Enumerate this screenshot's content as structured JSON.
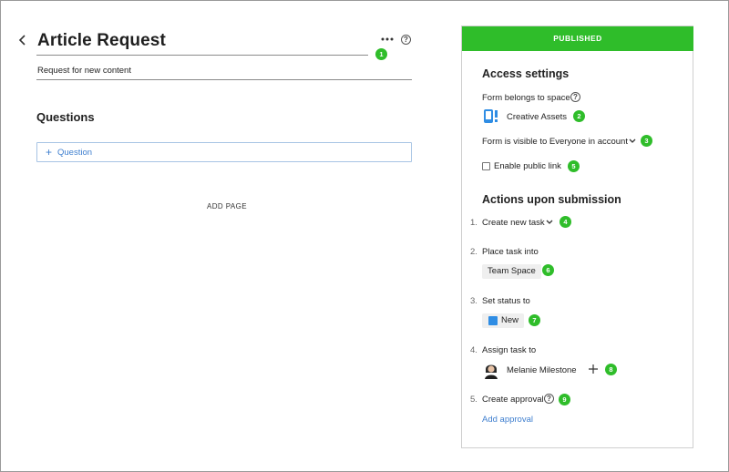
{
  "header": {
    "title": "Article Request",
    "description": "Request for new content",
    "back_icon": "chevron-left-icon",
    "more_icon": "more-horizontal-icon",
    "help_icon": "question-circle-icon"
  },
  "questions": {
    "heading": "Questions",
    "add_question_label": "Question",
    "add_page_label": "ADD PAGE"
  },
  "panel": {
    "status_banner": "PUBLISHED",
    "access": {
      "heading": "Access settings",
      "space_label": "Form belongs to space",
      "space_name": "Creative Assets",
      "visibility_text": "Form is visible to Everyone in account",
      "public_link_label": "Enable public link",
      "public_link_checked": false
    },
    "actions": {
      "heading": "Actions upon submission",
      "items": [
        {
          "number": "1.",
          "label": "Create new task"
        },
        {
          "number": "2.",
          "label": "Place task into",
          "value": "Team Space"
        },
        {
          "number": "3.",
          "label": "Set status to",
          "value": "New"
        },
        {
          "number": "4.",
          "label": "Assign task to",
          "value": "Melanie Milestone"
        },
        {
          "number": "5.",
          "label": "Create approval",
          "link": "Add approval"
        }
      ]
    }
  },
  "badges": [
    "1",
    "2",
    "3",
    "4",
    "5",
    "6",
    "7",
    "8",
    "9"
  ],
  "colors": {
    "published_green": "#2fbd2a",
    "badge_green": "#2fbd2a",
    "link_blue": "#3f7fcf",
    "status_new_blue": "#2f8de4",
    "space_icon_blue": "#2f8de4"
  }
}
